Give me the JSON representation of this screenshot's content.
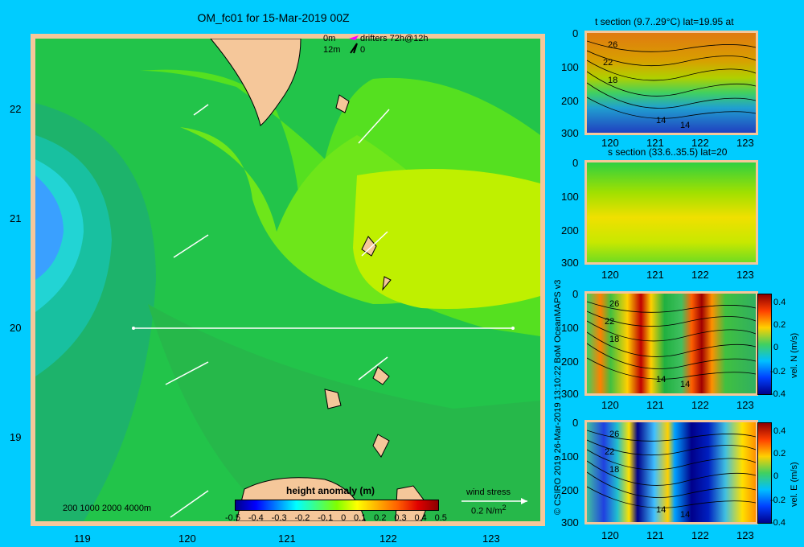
{
  "title": "OM_fc01 for 15-Mar-2019 00Z",
  "map": {
    "x_ticks": [
      "119",
      "120",
      "121",
      "122",
      "123"
    ],
    "y_ticks": [
      "22",
      "21",
      "20",
      "19"
    ],
    "drifters": {
      "line1": "0m",
      "line2": "12m",
      "label": "drifters 72h@12h",
      "marker": "0"
    },
    "depth_legend": "200  1000  2000  4000m",
    "colorbar": {
      "title": "height anomaly (m)",
      "ticks": [
        "-0.5",
        "-0.4",
        "-0.3",
        "-0.2",
        "-0.1",
        "0",
        "0.1",
        "0.2",
        "0.3",
        "0.4",
        "0.5"
      ]
    },
    "wind_stress": {
      "label": "wind stress",
      "value": "0.2 N/m",
      "superscript": "2"
    },
    "section_line": {
      "lat": 20,
      "lon_start": 119.5,
      "lon_end": 123.2
    }
  },
  "credits": "© CSIRO 2019   26-Mar-2019 13:10:22 BoM OceanMAPS v3",
  "sections": {
    "x_ticks": [
      "120",
      "121",
      "122",
      "123"
    ],
    "y_ticks": [
      "0",
      "100",
      "200",
      "300"
    ],
    "t": {
      "title": "t section (9.7..29°C) lat=19.95 at",
      "contours": [
        "26",
        "22",
        "18",
        "14",
        "14"
      ]
    },
    "s": {
      "title": "s section (33.6..35.5) lat=20"
    },
    "vn": {
      "cb_ticks": [
        "0.4",
        "0.2",
        "0",
        "-0.2",
        "-0.4"
      ],
      "cb_label": "vel. N (m/s)",
      "contours": [
        "26",
        "22",
        "18",
        "14",
        "14"
      ]
    },
    "ve": {
      "cb_ticks": [
        "0.4",
        "0.2",
        "0",
        "-0.2",
        "-0.4"
      ],
      "cb_label": "vel. E (m/s)",
      "contours": [
        "26",
        "22",
        "18",
        "14",
        "14"
      ]
    }
  },
  "colors": {
    "background": "#00ccff",
    "land": "#f5c79a",
    "ocean_green": "#22c44a",
    "light_green": "#55e020",
    "yellow_green": "#bff000"
  }
}
